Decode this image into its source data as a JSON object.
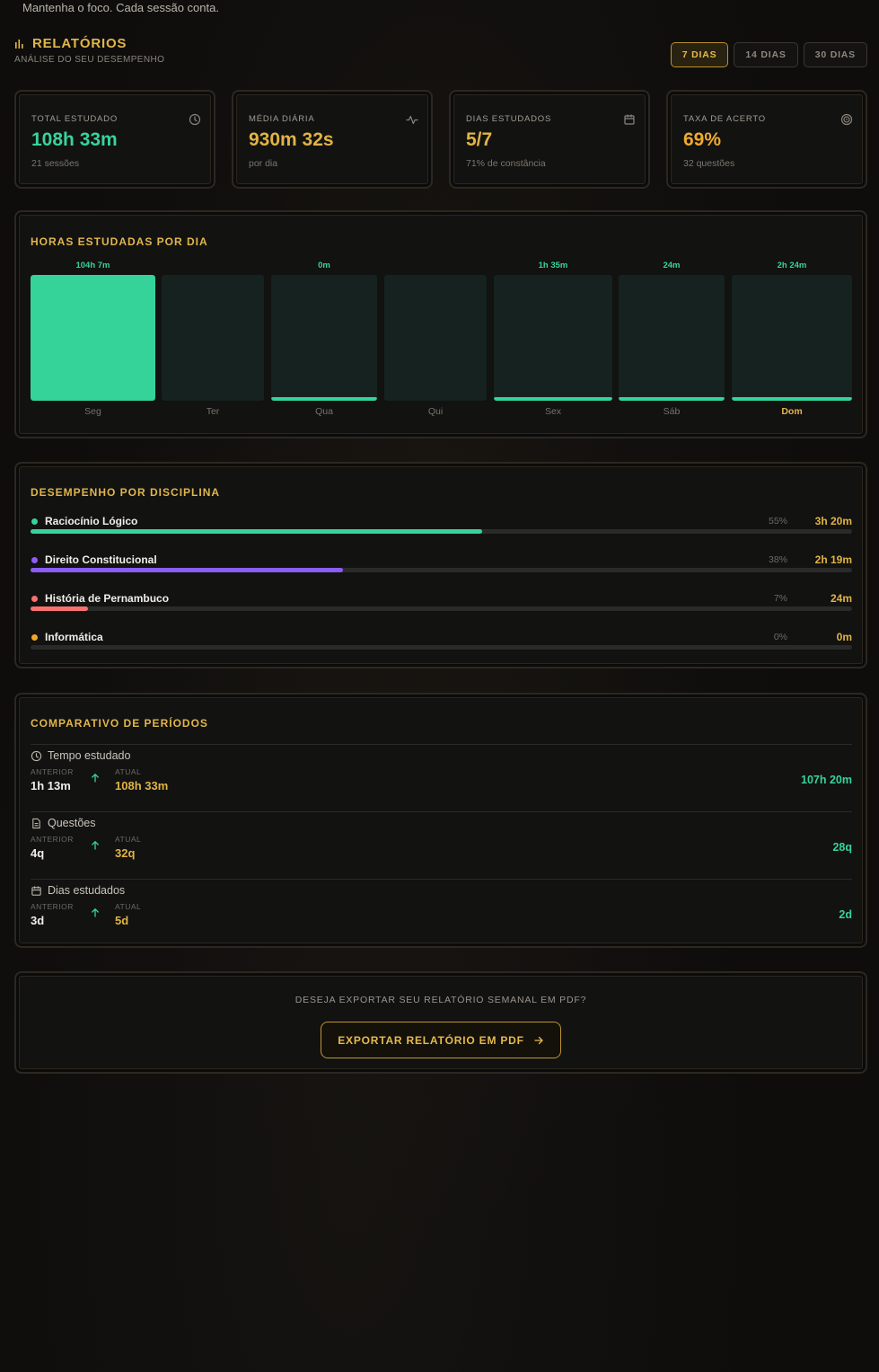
{
  "motto": "Mantenha o foco. Cada sessão conta.",
  "header": {
    "title": "RELATÓRIOS",
    "subtitle": "ANÁLISE DO SEU DESEMPENHO",
    "icon": "bar-chart-icon"
  },
  "range_buttons": [
    {
      "label": "7 DIAS",
      "active": true
    },
    {
      "label": "14 DIAS",
      "active": false
    },
    {
      "label": "30 DIAS",
      "active": false
    }
  ],
  "stats": [
    {
      "label": "TOTAL ESTUDADO",
      "value": "108h 33m",
      "sub": "21 sessões",
      "icon": "clock-icon",
      "color": "#37d39b"
    },
    {
      "label": "MÉDIA DIÁRIA",
      "value": "930m 32s",
      "sub": "por dia",
      "icon": "activity-icon",
      "color": "#e0b443"
    },
    {
      "label": "DIAS ESTUDADOS",
      "value": "5/7",
      "sub": "71% de constância",
      "icon": "calendar-icon",
      "color": "#e0b443"
    },
    {
      "label": "TAXA DE ACERTO",
      "value": "69%",
      "sub": "32 questões",
      "icon": "target-icon",
      "color": "#efaa2d"
    }
  ],
  "hours_chart": {
    "title": "HORAS ESTUDADAS POR DIA",
    "days": [
      {
        "day": "Seg",
        "label": "104h 7m",
        "fraction": 1.0,
        "today": false
      },
      {
        "day": "Ter",
        "label": "",
        "fraction": 0,
        "today": false
      },
      {
        "day": "Qua",
        "label": "0m",
        "fraction": 0.03,
        "today": false
      },
      {
        "day": "Qui",
        "label": "",
        "fraction": 0,
        "today": false
      },
      {
        "day": "Sex",
        "label": "1h 35m",
        "fraction": 0.03,
        "today": false
      },
      {
        "day": "Sáb",
        "label": "24m",
        "fraction": 0.03,
        "today": false
      },
      {
        "day": "Dom",
        "label": "2h 24m",
        "fraction": 0.03,
        "today": true
      }
    ]
  },
  "disciplines": {
    "title": "DESEMPENHO POR DISCIPLINA",
    "items": [
      {
        "name": "Raciocínio Lógico",
        "pct": "55%",
        "time": "3h 20m",
        "fraction": 0.55,
        "color": "#35d39a"
      },
      {
        "name": "Direito Constitucional",
        "pct": "38%",
        "time": "2h 19m",
        "fraction": 0.38,
        "color": "#8b5cf6"
      },
      {
        "name": "História de Pernambuco",
        "pct": "7%",
        "time": "24m",
        "fraction": 0.07,
        "color": "#f87171"
      },
      {
        "name": "Informática",
        "pct": "0%",
        "time": "0m",
        "fraction": 0,
        "color": "#f5a623"
      }
    ]
  },
  "comparison": {
    "title": "COMPARATIVO DE PERÍODOS",
    "prev_label": "ANTERIOR",
    "curr_label": "ATUAL",
    "rows": [
      {
        "label": "Tempo estudado",
        "icon": "clock-icon",
        "prev": "1h 13m",
        "curr": "108h 33m",
        "diff": "107h 20m"
      },
      {
        "label": "Questões",
        "icon": "document-icon",
        "prev": "4q",
        "curr": "32q",
        "diff": "28q"
      },
      {
        "label": "Dias estudados",
        "icon": "calendar-icon",
        "prev": "3d",
        "curr": "5d",
        "diff": "2d"
      }
    ]
  },
  "export": {
    "question": "DESEJA EXPORTAR SEU RELATÓRIO SEMANAL EM PDF?",
    "button": "EXPORTAR RELATÓRIO EM PDF"
  }
}
